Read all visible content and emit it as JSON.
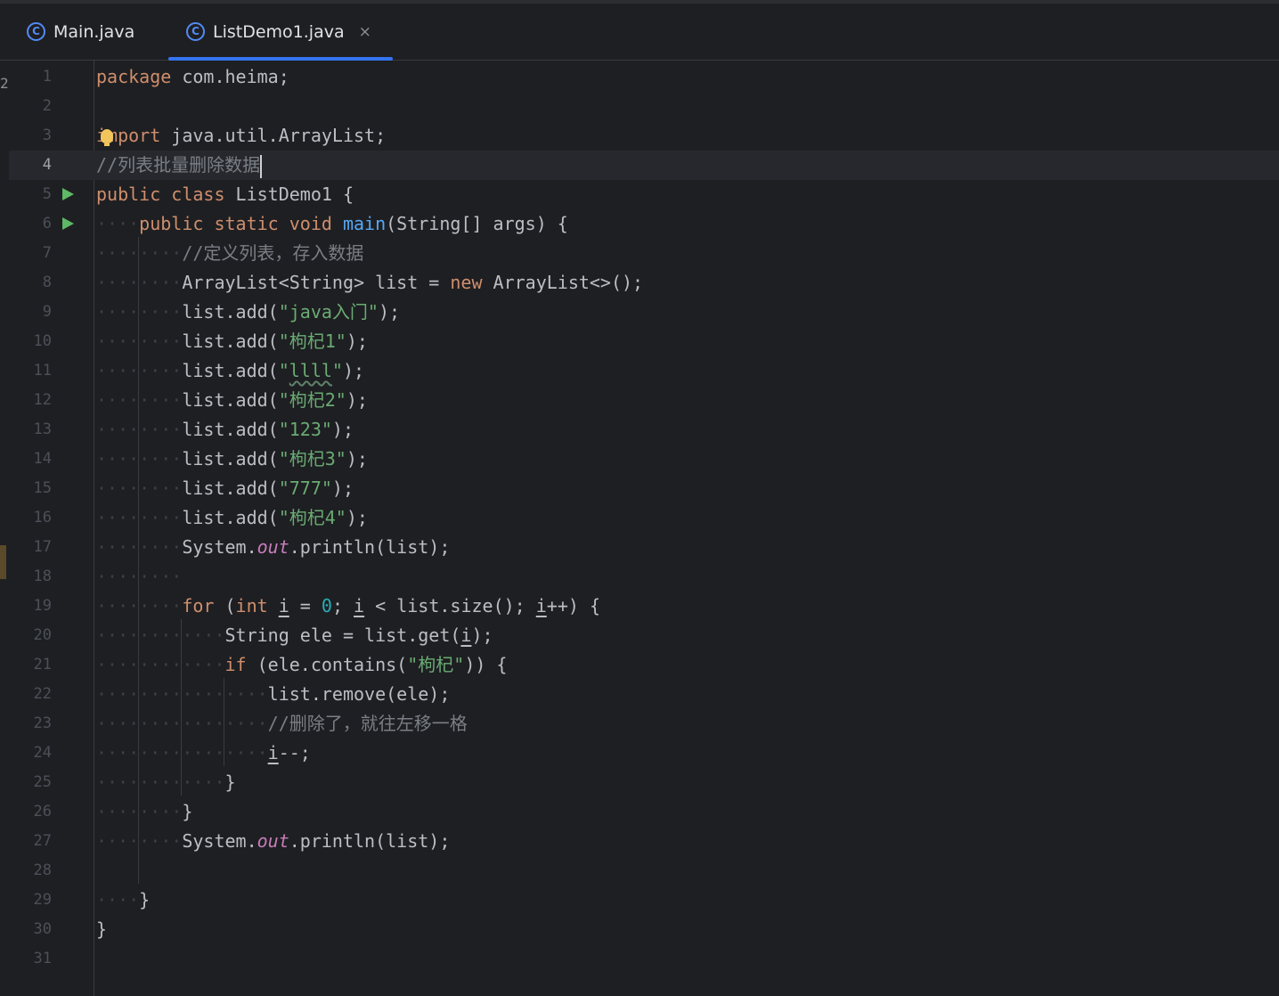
{
  "tabs": [
    {
      "label": "Main.java",
      "icon": "C",
      "active": false
    },
    {
      "label": "ListDemo1.java",
      "icon": "C",
      "active": true,
      "close": "×"
    }
  ],
  "left_edge_label": "2",
  "current_line": 4,
  "lines": [
    {
      "n": "1"
    },
    {
      "n": "2"
    },
    {
      "n": "3"
    },
    {
      "n": "4"
    },
    {
      "n": "5"
    },
    {
      "n": "6"
    },
    {
      "n": "7"
    },
    {
      "n": "8"
    },
    {
      "n": "9"
    },
    {
      "n": "10"
    },
    {
      "n": "11"
    },
    {
      "n": "12"
    },
    {
      "n": "13"
    },
    {
      "n": "14"
    },
    {
      "n": "15"
    },
    {
      "n": "16"
    },
    {
      "n": "17"
    },
    {
      "n": "18"
    },
    {
      "n": "19"
    },
    {
      "n": "20"
    },
    {
      "n": "21"
    },
    {
      "n": "22"
    },
    {
      "n": "23"
    },
    {
      "n": "24"
    },
    {
      "n": "25"
    },
    {
      "n": "26"
    },
    {
      "n": "27"
    },
    {
      "n": "28"
    },
    {
      "n": "29"
    },
    {
      "n": "30"
    },
    {
      "n": "31"
    }
  ],
  "code": {
    "l1": {
      "kw": "package",
      "rest": " com.heima;"
    },
    "l3": {
      "kw": "import",
      "rest": " java.util.ArrayList;"
    },
    "l4": {
      "comment": "//列表批量删除数据"
    },
    "l5": {
      "kw": "public class",
      "rest": " ListDemo1 {"
    },
    "l6": {
      "kw": "public static void",
      "fn": "main",
      "rest": "(String[] args) {"
    },
    "l7": {
      "comment": "//定义列表，存入数据"
    },
    "l8": {
      "a": "ArrayList<String> list = ",
      "kw": "new",
      "b": " ArrayList<>();"
    },
    "l9": {
      "a": "list.add(",
      "str": "\"java入门\"",
      "b": ");"
    },
    "l10": {
      "a": "list.add(",
      "str": "\"枸杞1\"",
      "b": ");"
    },
    "l11": {
      "a": "list.add(",
      "q1": "\"",
      "str": "llll",
      "q2": "\"",
      "b": ");"
    },
    "l12": {
      "a": "list.add(",
      "str": "\"枸杞2\"",
      "b": ");"
    },
    "l13": {
      "a": "list.add(",
      "str": "\"123\"",
      "b": ");"
    },
    "l14": {
      "a": "list.add(",
      "str": "\"枸杞3\"",
      "b": ");"
    },
    "l15": {
      "a": "list.add(",
      "str": "\"777\"",
      "b": ");"
    },
    "l16": {
      "a": "list.add(",
      "str": "\"枸杞4\"",
      "b": ");"
    },
    "l17": {
      "a": "System.",
      "field": "out",
      "b": ".println(list);"
    },
    "l19": {
      "kw1": "for",
      "p1": " (",
      "kw2": "int",
      "sp": " ",
      "i1": "i",
      "eq": " = ",
      "num": "0",
      "semi": "; ",
      "i2": "i",
      "lt": " < list.size(); ",
      "i3": "i",
      "end": "++) {"
    },
    "l20": {
      "a": "String ele = list.get(",
      "i": "i",
      "b": ");"
    },
    "l21": {
      "kw": "if",
      "a": " (ele.contains(",
      "str": "\"枸杞\"",
      "b": ")) {"
    },
    "l22": {
      "a": "list.remove(ele);"
    },
    "l23": {
      "comment": "//删除了，就往左移一格"
    },
    "l24": {
      "i": "i",
      "b": "--;"
    },
    "l25": {
      "a": "}"
    },
    "l26": {
      "a": "}"
    },
    "l27": {
      "a": "System.",
      "field": "out",
      "b": ".println(list);"
    },
    "l29": {
      "a": "}"
    },
    "l30": {
      "a": "}"
    }
  }
}
